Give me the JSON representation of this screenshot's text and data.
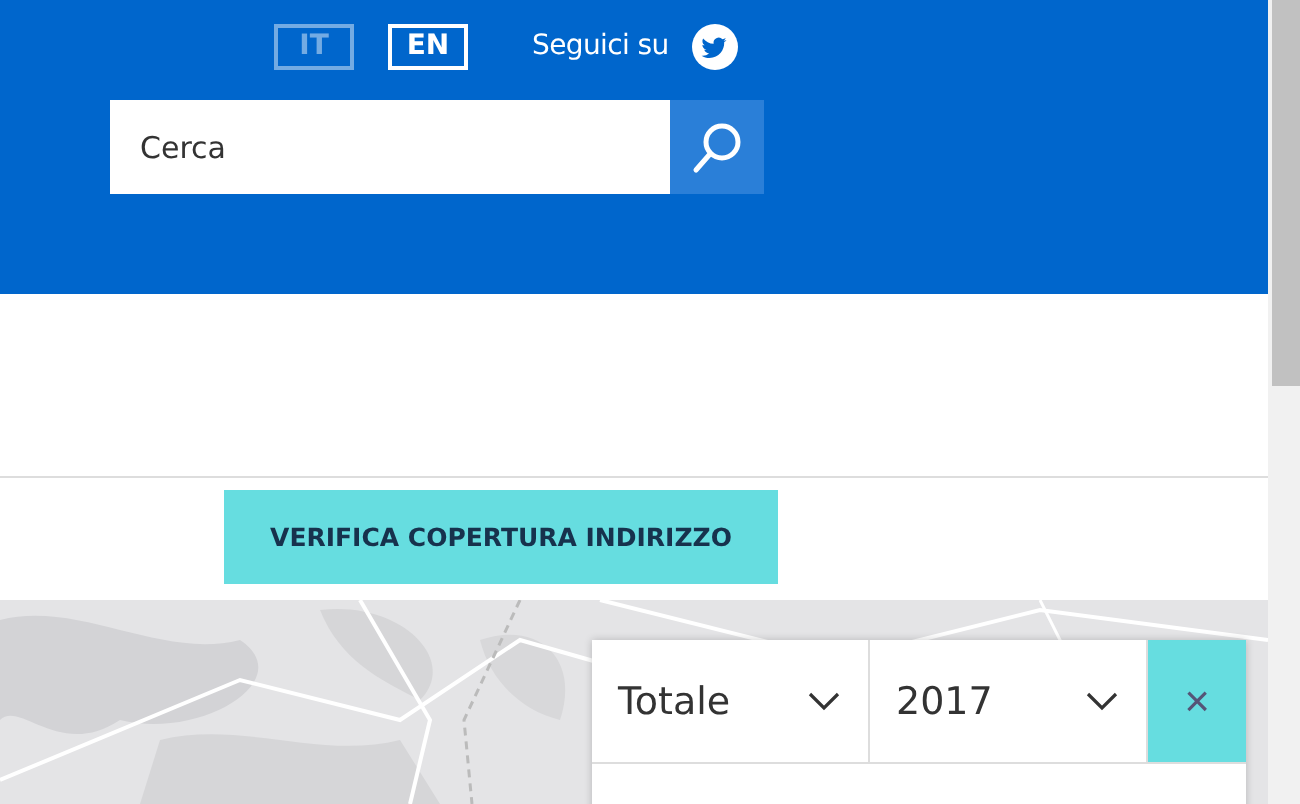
{
  "header": {
    "languages": [
      {
        "label": "IT",
        "selected": false
      },
      {
        "label": "EN",
        "selected": true
      }
    ],
    "follow_label": "Seguici su",
    "search": {
      "placeholder": "Cerca"
    }
  },
  "coverage_button": "VERIFICA COPERTURA INDIRIZZO",
  "map": {
    "kind": "picture",
    "filters": [
      {
        "value": "Totale"
      },
      {
        "value": "2017"
      }
    ],
    "close": "×"
  }
}
